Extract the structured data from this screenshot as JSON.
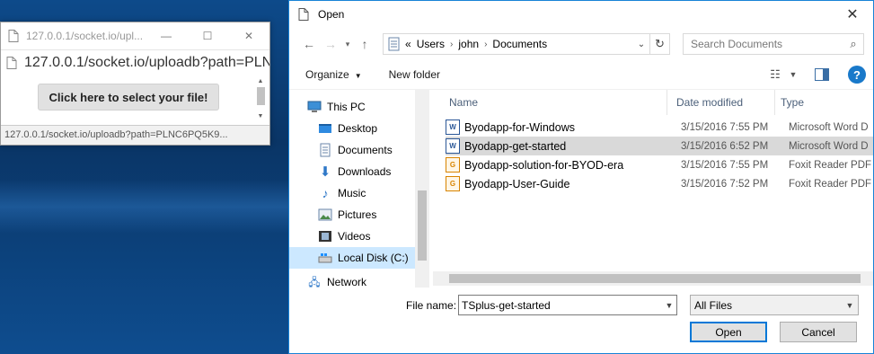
{
  "browser": {
    "title": "127.0.0.1/socket.io/upl...",
    "address": "127.0.0.1/socket.io/uploadb?path=PLN",
    "select_button": "Click here to select your file!",
    "status_url": "127.0.0.1/socket.io/uploadb?path=PLNC6PQ5K9..."
  },
  "dialog": {
    "title": "Open",
    "breadcrumb": {
      "prefix": "«",
      "items": [
        "Users",
        "john",
        "Documents"
      ]
    },
    "search": {
      "placeholder": "Search Documents"
    },
    "toolbar": {
      "organize": "Organize",
      "new_folder": "New folder"
    },
    "nav": {
      "items": [
        {
          "label": "This PC",
          "icon": "computer-icon"
        },
        {
          "label": "Desktop",
          "icon": "desktop-folder-icon"
        },
        {
          "label": "Documents",
          "icon": "documents-folder-icon"
        },
        {
          "label": "Downloads",
          "icon": "download-arrow-icon"
        },
        {
          "label": "Music",
          "icon": "music-note-icon"
        },
        {
          "label": "Pictures",
          "icon": "pictures-folder-icon"
        },
        {
          "label": "Videos",
          "icon": "videos-folder-icon"
        },
        {
          "label": "Local Disk (C:)",
          "icon": "drive-icon",
          "selected": true
        },
        {
          "label": "Network",
          "icon": "network-icon"
        }
      ]
    },
    "columns": {
      "name": "Name",
      "date": "Date modified",
      "type": "Type"
    },
    "files": [
      {
        "name": "Byodapp-for-Windows",
        "date": "3/15/2016 7:55 PM",
        "type": "Microsoft Word D",
        "icon": "word-doc-icon"
      },
      {
        "name": "Byodapp-get-started",
        "date": "3/15/2016 6:52 PM",
        "type": "Microsoft Word D",
        "icon": "word-doc-icon",
        "selected": true
      },
      {
        "name": "Byodapp-solution-for-BYOD-era",
        "date": "3/15/2016 7:55 PM",
        "type": "Foxit Reader PDF",
        "icon": "pdf-doc-icon"
      },
      {
        "name": "Byodapp-User-Guide",
        "date": "3/15/2016 7:52 PM",
        "type": "Foxit Reader PDF",
        "icon": "pdf-doc-icon"
      }
    ],
    "filename_label": "File name:",
    "filename_value": "TSplus-get-started",
    "filter_value": "All Files",
    "open_button": "Open",
    "cancel_button": "Cancel"
  },
  "colors": {
    "accent": "#0078d7",
    "selected_nav": "#cce8ff",
    "selected_row": "#d9d9d9"
  }
}
